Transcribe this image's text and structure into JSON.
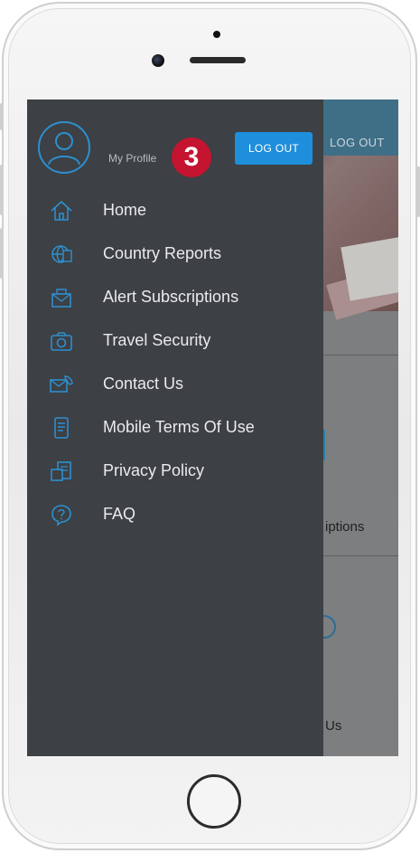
{
  "app": {
    "background": {
      "logout_label": "LOG OUT",
      "subscriptions_fragment": "iptions",
      "contact_fragment": "Us"
    },
    "drawer": {
      "profile_label": "My Profile",
      "step_badge": "3",
      "logout_label": "LOG OUT",
      "menu": [
        {
          "label": "Home",
          "icon": "home-icon"
        },
        {
          "label": "Country Reports",
          "icon": "country-reports-icon"
        },
        {
          "label": "Alert Subscriptions",
          "icon": "alert-subscriptions-icon"
        },
        {
          "label": "Travel Security",
          "icon": "travel-security-icon"
        },
        {
          "label": "Contact Us",
          "icon": "contact-us-icon"
        },
        {
          "label": "Mobile Terms Of Use",
          "icon": "mobile-terms-icon"
        },
        {
          "label": "Privacy Policy",
          "icon": "privacy-policy-icon"
        },
        {
          "label": "FAQ",
          "icon": "faq-icon"
        }
      ]
    },
    "colors": {
      "accent": "#1e8fdb",
      "drawer_bg": "#3d4044",
      "badge": "#c41430"
    }
  }
}
